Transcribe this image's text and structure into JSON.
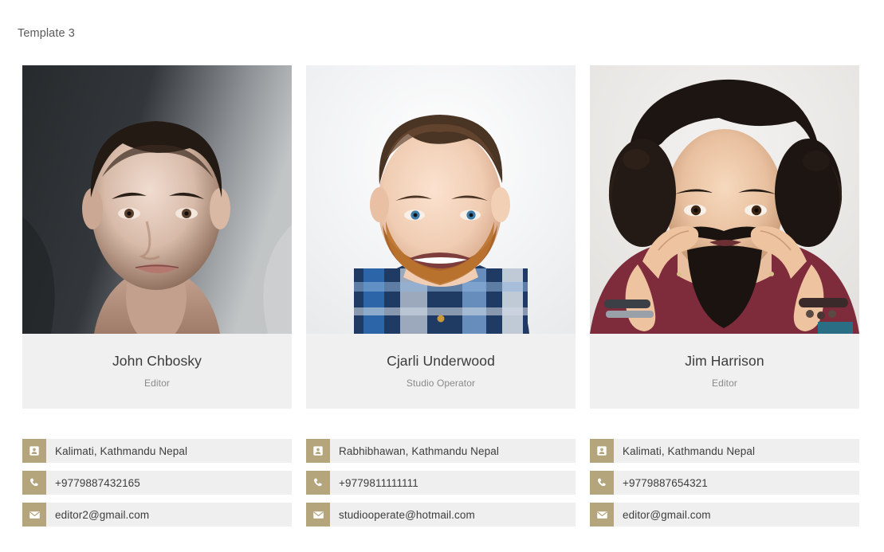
{
  "page": {
    "title": "Template 3",
    "accent_color": "#b4a57c",
    "panel_color": "#f0f0f0",
    "row_color": "#efefef",
    "background_color": "#ffffff"
  },
  "members": [
    {
      "name": "John Chbosky",
      "role": "Editor",
      "photo_alt": "portrait-young-man-dark-background",
      "contacts": [
        {
          "icon": "address-card-icon",
          "label": "Kalimati, Kathmandu Nepal"
        },
        {
          "icon": "phone-icon",
          "label": "+9779887432165"
        },
        {
          "icon": "envelope-icon",
          "label": "editor2@gmail.com"
        }
      ]
    },
    {
      "name": "Cjarli Underwood",
      "role": "Studio Operator",
      "photo_alt": "portrait-smiling-bearded-man-plaid-shirt",
      "contacts": [
        {
          "icon": "address-card-icon",
          "label": "Rabhibhawan, Kathmandu Nepal"
        },
        {
          "icon": "phone-icon",
          "label": "+9779811111111"
        },
        {
          "icon": "envelope-icon",
          "label": "studiooperate@hotmail.com"
        }
      ]
    },
    {
      "name": "Jim Harrison",
      "role": "Editor",
      "photo_alt": "portrait-man-curly-hair-twirling-moustache",
      "contacts": [
        {
          "icon": "address-card-icon",
          "label": "Kalimati, Kathmandu Nepal"
        },
        {
          "icon": "phone-icon",
          "label": "+9779887654321"
        },
        {
          "icon": "envelope-icon",
          "label": "editor@gmail.com"
        }
      ]
    }
  ]
}
